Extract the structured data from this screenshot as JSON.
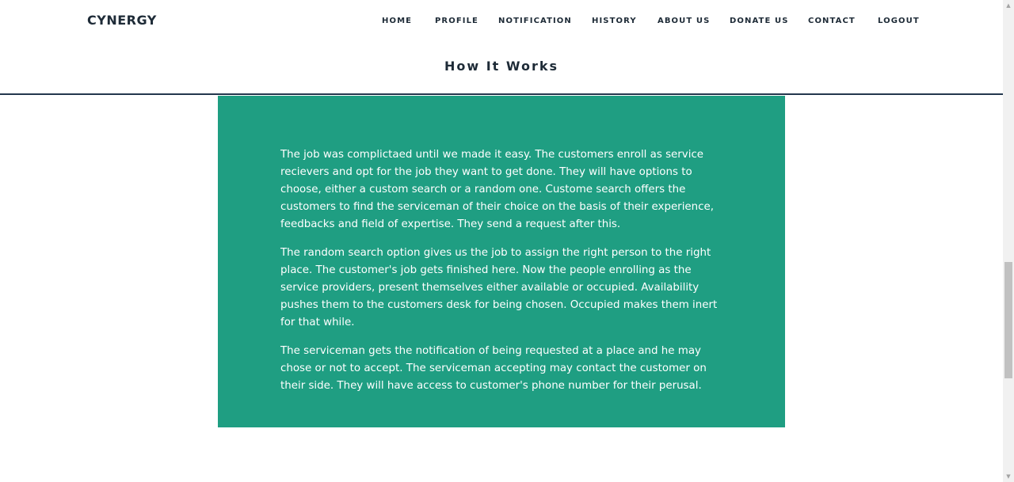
{
  "header": {
    "logo": "CYNERGY",
    "nav": [
      {
        "label": "HOME"
      },
      {
        "label": "PROFILE"
      },
      {
        "label": "NOTIFICATION"
      },
      {
        "label": "HISTORY"
      },
      {
        "label": "ABOUT US"
      },
      {
        "label": "DONATE US"
      },
      {
        "label": "CONTACT"
      },
      {
        "label": "LOGOUT"
      }
    ],
    "section_title": "How It Works"
  },
  "content": {
    "paragraphs": [
      "The job was complictaed until we made it easy. The customers enroll as service recievers and opt for the job they want to get done. They will have options to choose, either a custom search or a random one. Custome search offers the customers to find the serviceman of their choice on the basis of their experience, feedbacks and field of expertise. They send a request after this.",
      "The random search option gives us the job to assign the right person to the right place. The customer's job gets finished here. Now the people enrolling as the service providers, present themselves either available or occupied. Availability pushes them to the customers desk for being chosen. Occupied makes them inert for that while.",
      "The serviceman gets the notification of being requested at a place and he may chose or not to accept. The serviceman accepting may contact the customer on their side. They will have access to customer's phone number for their perusal."
    ]
  },
  "scrollbar": {
    "up_icon": "▲",
    "down_icon": "▼"
  },
  "colors": {
    "accent": "#1f9e82",
    "text_dark": "#1e2b37",
    "header_border": "#23374d"
  }
}
